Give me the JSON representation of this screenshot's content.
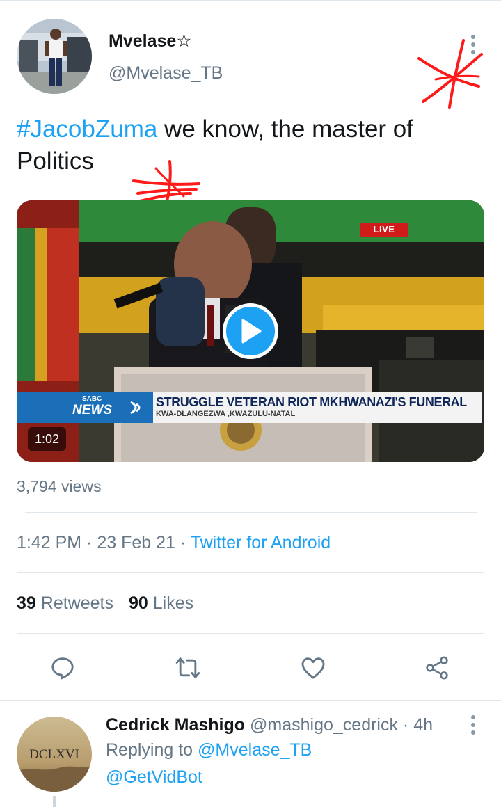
{
  "tweet": {
    "author": {
      "display_name": "Mvelase☆",
      "handle": "@Mvelase_TB",
      "avatar_icon": "user-avatar-photo"
    },
    "text": {
      "hashtag": "#JacobZuma",
      "body": " we know, the master of Politics"
    },
    "video": {
      "live_label": "LIVE",
      "channel_small": "SABC",
      "channel_big": "NEWS",
      "headline": "STRUGGLE VETERAN RIOT MKHWANAZI'S FUNERAL",
      "location": "KWA-DLANGEZWA ,KWAZULU-NATAL",
      "duration": "1:02",
      "play_icon": "play-icon"
    },
    "views": "3,794 views",
    "meta": {
      "time": "1:42 PM",
      "separator": " · ",
      "date": "23 Feb 21",
      "source": "Twitter for Android"
    },
    "stats": {
      "retweets_count": "39",
      "retweets_label": " Retweets",
      "likes_count": "90",
      "likes_label": " Likes"
    },
    "actions": [
      "reply-icon",
      "retweet-icon",
      "like-icon",
      "share-icon"
    ]
  },
  "reply": {
    "display_name": "Cedrick Mashigo",
    "handle": " @mashigo_cedrick · 4h",
    "replying_prefix": "Replying to ",
    "replying_to": "@Mvelase_TB",
    "text": "@GetVidBot",
    "avatar_text": "DCLXVI"
  },
  "colors": {
    "accent": "#1da1f2",
    "secondary_text": "#657786",
    "annotation_red": "#ff1a1a"
  }
}
